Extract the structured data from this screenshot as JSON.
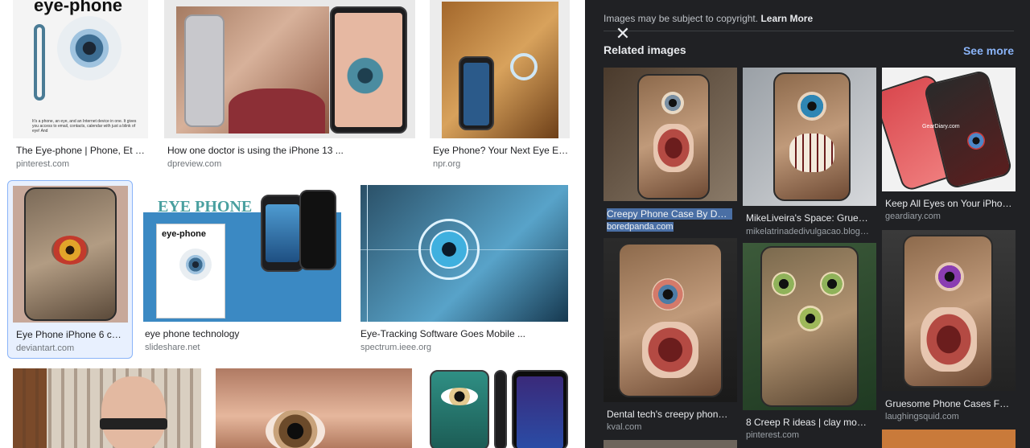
{
  "results": [
    {
      "title": "The Eye-phone | Phone, Et ph...",
      "site": "pinterest.com",
      "thumb_text": "eye-phone",
      "caption_text": "It's a phone, an eye, and an Internet device in one. It gives you access to email, contacts, calendar with just a blink of eye! And"
    },
    {
      "title": "How one doctor is using the iPhone 13 ...",
      "site": "dpreview.com"
    },
    {
      "title": "Eye Phone? Your Next Eye Exa...",
      "site": "npr.org"
    },
    {
      "title": "Eye Phone iPhone 6 cas...",
      "site": "deviantart.com"
    },
    {
      "title": "eye phone technology",
      "site": "slideshare.net",
      "thumb_heading": "EYE PHONE",
      "thumb_sub": "eye-phone"
    },
    {
      "title": "Eye-Tracking Software Goes Mobile ...",
      "site": "spectrum.ieee.org"
    }
  ],
  "panel": {
    "copyright_text": "Images may be subject to copyright.",
    "learn_more": "Learn More",
    "related_title": "Related images",
    "see_more": "See more",
    "close_label": "✕",
    "related": [
      {
        "title": "Creepy Phone Case By Denta...",
        "site": "boredpanda.com"
      },
      {
        "title": "MikeLiveira's Space: Grueso...",
        "site": "mikelatrinadedivulgacao.blogs..."
      },
      {
        "title": "Keep All Eyes on Your iPhon...",
        "site": "geardiary.com",
        "watermark": "GearDiary.com"
      },
      {
        "title": "Dental tech's creepy phone c...",
        "site": "kval.com"
      },
      {
        "title": "8 Creep R ideas | clay monst...",
        "site": "pinterest.com"
      },
      {
        "title": "Gruesome Phone Cases Fea...",
        "site": "laughingsquid.com"
      }
    ]
  },
  "colors": {
    "panel_bg": "#202124",
    "link_blue": "#8ab4f8",
    "selected_border": "#8ab4f8"
  }
}
